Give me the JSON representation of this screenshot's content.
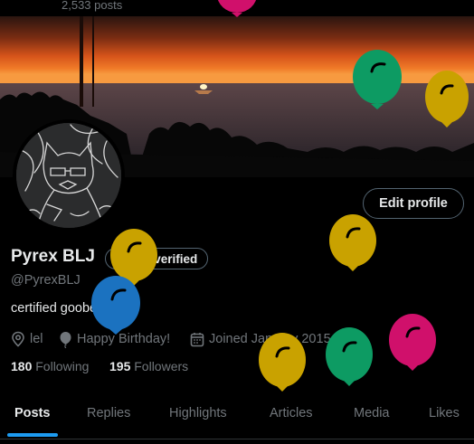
{
  "header": {
    "post_count": "2,533 posts"
  },
  "profile": {
    "display_name": "Pyrex BLJ",
    "verify_label": "Get verified",
    "handle": "@PyrexBLJ",
    "bio": "certified goober",
    "location": "lel",
    "birthday": "Happy Birthday!",
    "joined": "Joined January 2015",
    "following_count": "180",
    "following_label": "Following",
    "followers_count": "195",
    "followers_label": "Followers",
    "edit_label": "Edit profile"
  },
  "tabs": [
    {
      "label": "Posts",
      "active": true
    },
    {
      "label": "Replies",
      "active": false
    },
    {
      "label": "Highlights",
      "active": false
    },
    {
      "label": "Articles",
      "active": false
    },
    {
      "label": "Media",
      "active": false
    },
    {
      "label": "Likes",
      "active": false
    }
  ],
  "colors": {
    "accent": "#1d9bf0",
    "text_primary": "#e7e9ea",
    "text_secondary": "#71767b",
    "border": "#536471",
    "balloon_yellow": "#c9a200",
    "balloon_green": "#0d9b63",
    "balloon_magenta": "#d0106b",
    "balloon_blue": "#1b72c0"
  },
  "icons": {
    "location": "location-pin-icon",
    "birthday": "balloon-icon",
    "joined": "calendar-icon",
    "verify": "verified-badge-icon"
  }
}
